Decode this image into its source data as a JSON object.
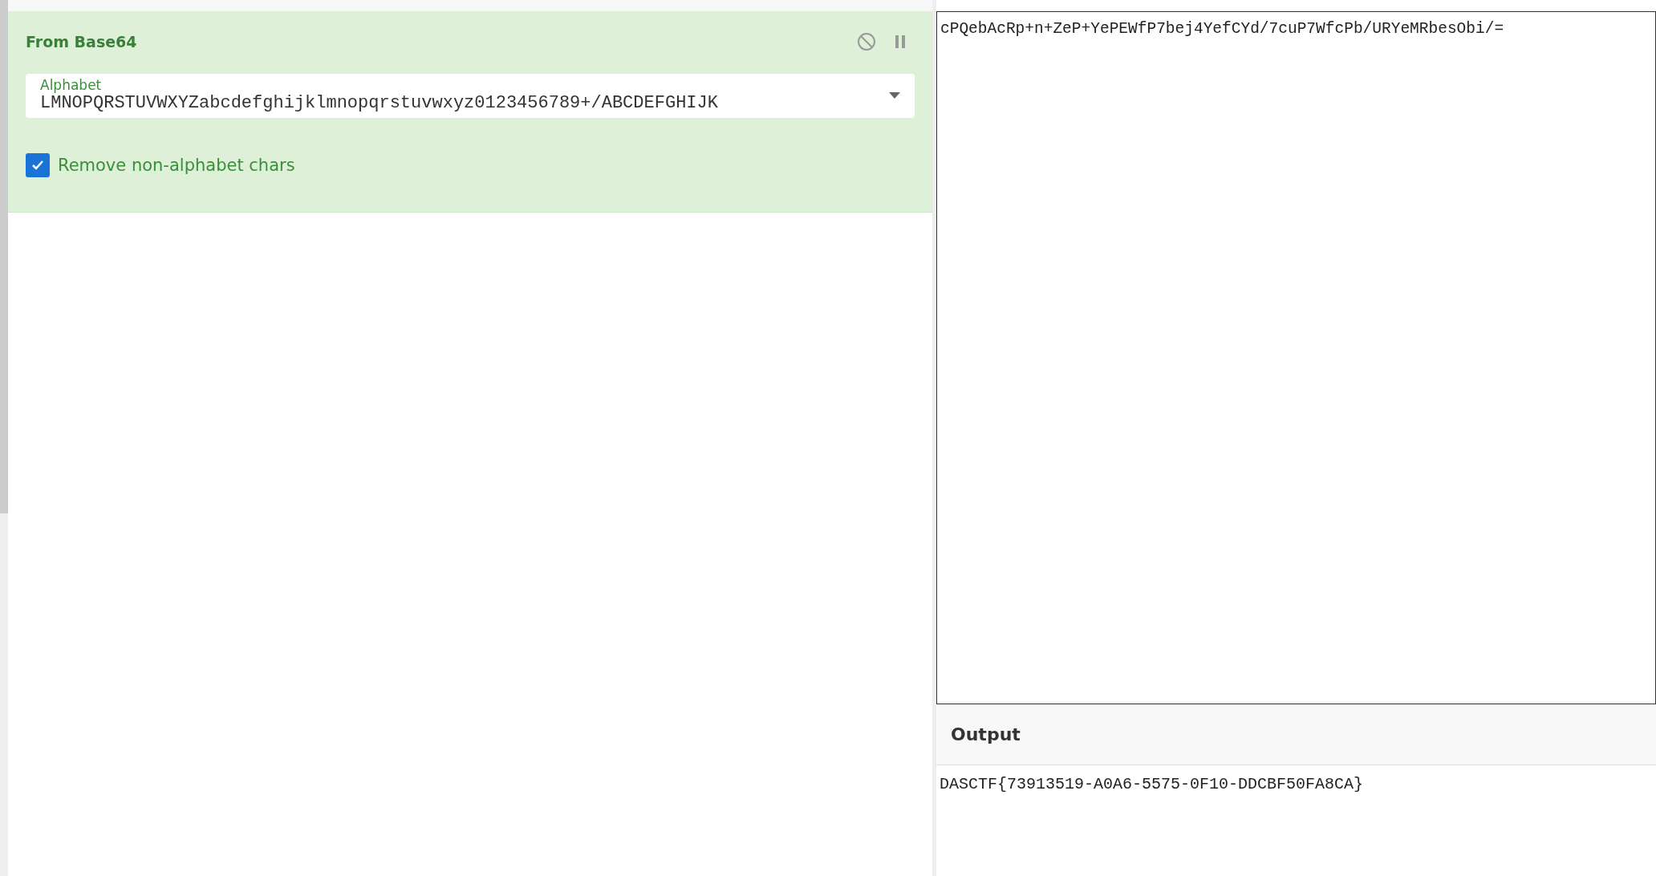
{
  "recipe": {
    "operation": {
      "title": "From Base64",
      "alphabet": {
        "label": "Alphabet",
        "value": "LMNOPQRSTUVWXYZabcdefghijklmnopqrstuvwxyz0123456789+/ABCDEFGHIJK"
      },
      "remove_non_alphabet": {
        "label": "Remove non-alphabet chars",
        "checked": true
      }
    }
  },
  "input": {
    "value": "cPQebAcRp+n+ZeP+YePEWfP7bej4YefCYd/7cuP7WfcPb/URYeMRbesObi/="
  },
  "output": {
    "title": "Output",
    "value": "DASCTF{73913519-A0A6-5575-0F10-DDCBF50FA8CA}"
  }
}
